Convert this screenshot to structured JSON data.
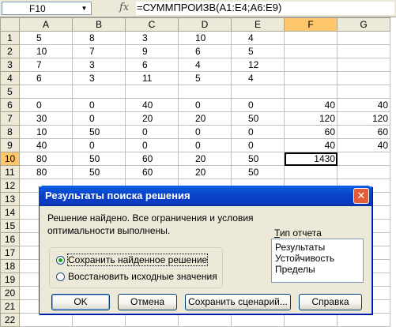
{
  "formula_bar": {
    "name_box": "F10",
    "fx": "fx",
    "formula": "=СУММПРОИЗВ(A1:E4;A6:E9)"
  },
  "sheet": {
    "columns": [
      "A",
      "B",
      "C",
      "D",
      "E",
      "F",
      "G"
    ],
    "selected_column": "F",
    "selected_row": "10",
    "rows": [
      {
        "row": "1",
        "cells": [
          "5",
          "8",
          "3",
          "10",
          "4",
          "",
          ""
        ]
      },
      {
        "row": "2",
        "cells": [
          "10",
          "7",
          "9",
          "6",
          "5",
          "",
          ""
        ]
      },
      {
        "row": "3",
        "cells": [
          "7",
          "3",
          "6",
          "4",
          "12",
          "",
          ""
        ]
      },
      {
        "row": "4",
        "cells": [
          "6",
          "3",
          "11",
          "5",
          "4",
          "",
          ""
        ]
      },
      {
        "row": "5",
        "cells": [
          "",
          "",
          "",
          "",
          "",
          "",
          ""
        ]
      },
      {
        "row": "6",
        "cells": [
          "0",
          "0",
          "40",
          "0",
          "0",
          "40",
          "40"
        ]
      },
      {
        "row": "7",
        "cells": [
          "30",
          "0",
          "20",
          "20",
          "50",
          "120",
          "120"
        ]
      },
      {
        "row": "8",
        "cells": [
          "10",
          "50",
          "0",
          "0",
          "0",
          "60",
          "60"
        ]
      },
      {
        "row": "9",
        "cells": [
          "40",
          "0",
          "0",
          "0",
          "0",
          "40",
          "40"
        ]
      },
      {
        "row": "10",
        "cells": [
          "80",
          "50",
          "60",
          "20",
          "50",
          "1430",
          ""
        ]
      },
      {
        "row": "11",
        "cells": [
          "80",
          "50",
          "60",
          "20",
          "50",
          "",
          ""
        ]
      },
      {
        "row": "12",
        "cells": [
          "",
          "",
          "",
          "",
          "",
          "",
          ""
        ]
      },
      {
        "row": "13",
        "cells": [
          "",
          "",
          "",
          "",
          "",
          "",
          ""
        ]
      },
      {
        "row": "14",
        "cells": [
          "",
          "",
          "",
          "",
          "",
          "",
          ""
        ]
      },
      {
        "row": "15",
        "cells": [
          "",
          "",
          "",
          "",
          "",
          "",
          ""
        ]
      },
      {
        "row": "16",
        "cells": [
          "",
          "",
          "",
          "",
          "",
          "",
          ""
        ]
      },
      {
        "row": "17",
        "cells": [
          "",
          "",
          "",
          "",
          "",
          "",
          ""
        ]
      },
      {
        "row": "18",
        "cells": [
          "",
          "",
          "",
          "",
          "",
          "",
          ""
        ]
      },
      {
        "row": "19",
        "cells": [
          "",
          "",
          "",
          "",
          "",
          "",
          ""
        ]
      },
      {
        "row": "20",
        "cells": [
          "",
          "",
          "",
          "",
          "",
          "",
          ""
        ]
      },
      {
        "row": "21",
        "cells": [
          "",
          "",
          "",
          "",
          "",
          "",
          ""
        ]
      },
      {
        "row": "22",
        "cells": [
          "",
          "",
          "",
          "",
          "",
          "",
          ""
        ]
      }
    ]
  },
  "dialog": {
    "title": "Результаты поиска решения",
    "message_line1": "Решение найдено. Все ограничения и условия",
    "message_line2": "оптимальности выполнены.",
    "report_type_label": "Тип отчета",
    "report_types": [
      "Результаты",
      "Устойчивость",
      "Пределы"
    ],
    "options": [
      {
        "label": "Сохранить найденное решение",
        "checked": true
      },
      {
        "label": "Восстановить исходные значения",
        "checked": false
      }
    ],
    "buttons": {
      "ok": "OK",
      "cancel": "Отмена",
      "save_scenario": "Сохранить сценарий...",
      "help": "Справка"
    },
    "close": "✕"
  }
}
